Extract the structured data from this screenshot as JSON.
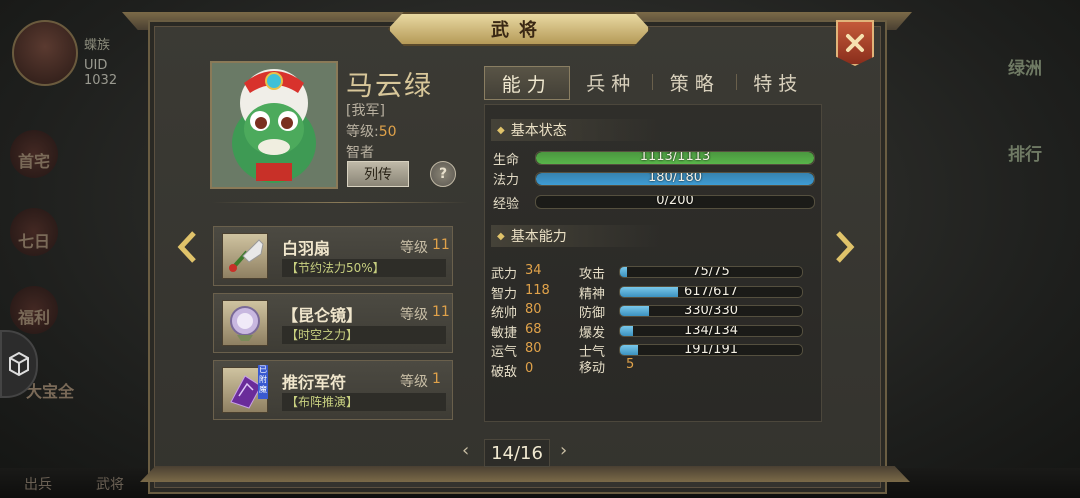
{
  "background": {
    "player_name": "蝶族",
    "uid": "UID 1032",
    "left_menu": [
      "首宅",
      "七日",
      "福利",
      "大宝全"
    ],
    "right_menu": [
      "绿洲",
      "排行"
    ],
    "bottom_menu": [
      "出兵",
      "武将"
    ]
  },
  "window": {
    "title": "武将"
  },
  "hero": {
    "name": "马云绿",
    "faction": "[我军]",
    "level_label": "等级:",
    "level": "50",
    "class": "智者",
    "bio_button": "列传",
    "help_button": "?"
  },
  "equipment": [
    {
      "name": "白羽扇",
      "level_label": "等级",
      "level": "11",
      "desc": "【节约法力50%】",
      "tag": ""
    },
    {
      "name": "【昆仑镜】",
      "level_label": "等级",
      "level": "11",
      "desc": "【时空之力】",
      "tag": ""
    },
    {
      "name": "推衍军符",
      "level_label": "等级",
      "level": "1",
      "desc": "【布阵推演】",
      "tag": "已附魔"
    }
  ],
  "tabs": [
    "能力",
    "兵种",
    "策略",
    "特技"
  ],
  "basic_status": {
    "header": "基本状态",
    "hp": {
      "label": "生命",
      "text": "1113/1113",
      "fraction": 1.0,
      "color": "#58b64a"
    },
    "mp": {
      "label": "法力",
      "text": "180/180",
      "fraction": 1.0,
      "color": "#3e9cd4"
    },
    "exp": {
      "label": "经验",
      "text": "0/200",
      "fraction": 0.0,
      "color": "#3e9cd4"
    }
  },
  "basic_ability": {
    "header": "基本能力",
    "attributes": [
      {
        "name": "武力",
        "value": "34"
      },
      {
        "name": "智力",
        "value": "118"
      },
      {
        "name": "统帅",
        "value": "80"
      },
      {
        "name": "敏捷",
        "value": "68"
      },
      {
        "name": "运气",
        "value": "80"
      },
      {
        "name": "破敌",
        "value": "0"
      }
    ],
    "combat": [
      {
        "name": "攻击",
        "text": "75/75",
        "fraction": 0.04
      },
      {
        "name": "精神",
        "text": "617/617",
        "fraction": 0.32
      },
      {
        "name": "防御",
        "text": "330/330",
        "fraction": 0.16
      },
      {
        "name": "爆发",
        "text": "134/134",
        "fraction": 0.07
      },
      {
        "name": "士气",
        "text": "191/191",
        "fraction": 0.1
      }
    ],
    "move_label": "移动",
    "move_value": "5"
  },
  "pager": {
    "text": "14/16"
  }
}
